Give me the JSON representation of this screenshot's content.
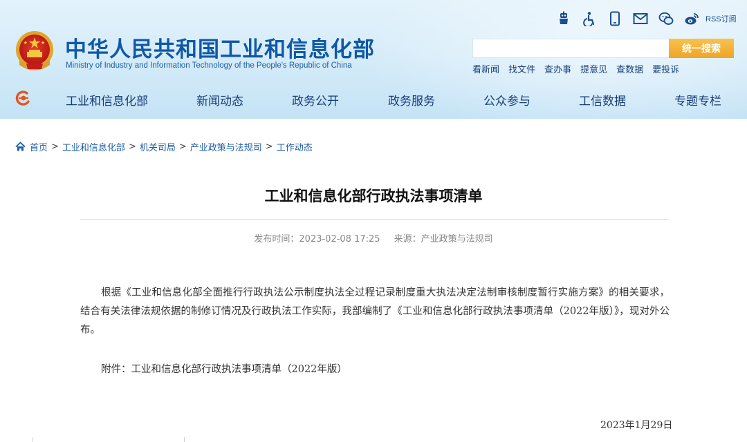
{
  "header": {
    "title_cn": "中华人民共和国工业和信息化部",
    "title_en": "Ministry of Industry and Information Technology of the People's Republic of China",
    "tools": {
      "rss_label": "RSS订阅",
      "icons": [
        "ai-assistant-icon",
        "accessibility-icon",
        "mobile-icon",
        "mail-icon",
        "wechat-icon",
        "weibo-icon",
        "rss-icon"
      ]
    },
    "search": {
      "value": "",
      "placeholder": "",
      "button_label": "统一搜索"
    },
    "quick_links": [
      "看新闻",
      "找文件",
      "查办事",
      "提意见",
      "查数据",
      "要投诉"
    ]
  },
  "nav": {
    "items": [
      "工业和信息化部",
      "新闻动态",
      "政务公开",
      "政务服务",
      "公众参与",
      "工信数据",
      "专题专栏"
    ]
  },
  "breadcrumb": [
    "首页",
    "工业和信息化部",
    "机关司局",
    "产业政策与法规司",
    "工作动态"
  ],
  "article": {
    "title": "工业和信息化部行政执法事项清单",
    "publish_label": "发布时间：",
    "publish_time": "2023-02-08 17:25",
    "source_label": "来源：",
    "source": "产业政策与法规司",
    "paragraph": "根据《工业和信息化部全面推行行政执法公示制度执法全过程记录制度重大执法决定法制审核制度暂行实施方案》的相关要求，结合有关法律法规依据的制修订情况及行政执法工作实际，我部编制了《工业和信息化部行政执法事项清单（2022年版）》，现对外公布。",
    "attachment_label": "附件：",
    "attachment": "工业和信息化部行政执法事项清单（2022年版）",
    "date": "2023年1月29日"
  },
  "colors": {
    "brand_blue": "#0f58a8",
    "nav_text": "#183c74",
    "search_button": "#eea52a",
    "link": "#1f5ea8"
  }
}
